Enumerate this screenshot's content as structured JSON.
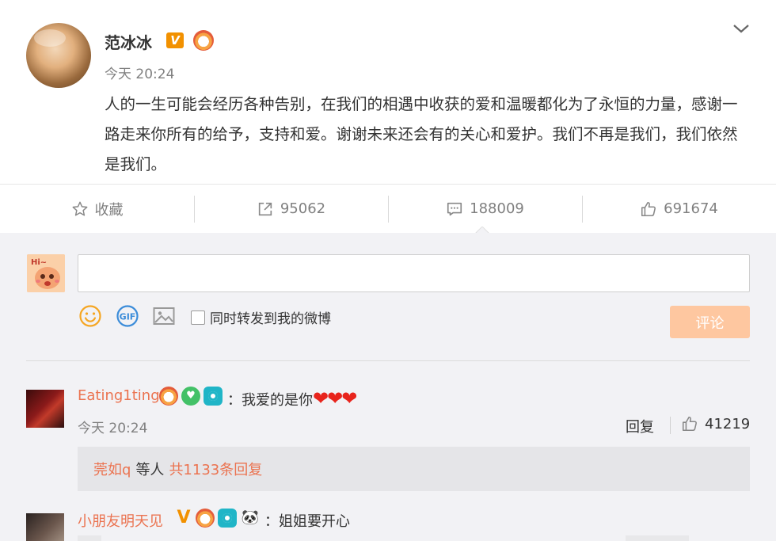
{
  "post": {
    "author": "范冰冰",
    "verified_badge": "V",
    "time": "今天 20:24",
    "content": "人的一生可能会经历各种告别，在我们的相遇中收获的爱和温暖都化为了永恒的力量，感谢一路走来你所有的给予，支持和爱。谢谢未来还会有的关心和爱护。我们不再是我们，我们依然是我们。"
  },
  "actions": {
    "favorite_label": "收藏",
    "repost_count": "95062",
    "comment_count": "188009",
    "like_count": "691674"
  },
  "composer": {
    "input_value": "",
    "forward_label": "同时转发到我的微博",
    "submit_label": "评论",
    "submit_color": "#fec7a0"
  },
  "comments": [
    {
      "user": "Eating1ting",
      "text": "：我爱的是你",
      "hearts": "❤❤❤",
      "time": "今天 20:24",
      "reply_label": "回复",
      "likes": "41219",
      "replies": {
        "user": "莞如q",
        "middle": "等人",
        "count": "共1133条回复"
      }
    },
    {
      "user": "小朋友明天见",
      "vip": "V",
      "panda": "🐼",
      "text": "：姐姐要开心"
    }
  ],
  "colors": {
    "link": "#eb7350",
    "muted": "#808080",
    "verified": "#f29100",
    "comment_bg": "#f2f2f5"
  }
}
